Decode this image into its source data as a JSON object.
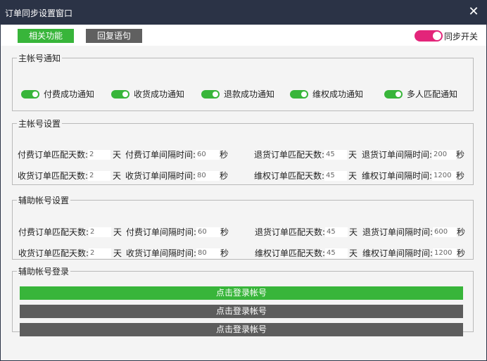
{
  "window": {
    "title": "订单同步设置窗口",
    "close_glyph": "✕"
  },
  "tabs": [
    {
      "label": "相关功能"
    },
    {
      "label": "回复语句"
    }
  ],
  "sync_toggle": {
    "label": "同步开关",
    "on": true,
    "color": "#e3257a"
  },
  "main_notify": {
    "legend": "主帐号通知",
    "items": [
      {
        "label": "付费成功通知",
        "on": true
      },
      {
        "label": "收货成功通知",
        "on": true
      },
      {
        "label": "退款成功通知",
        "on": true
      },
      {
        "label": "维权成功通知",
        "on": true
      },
      {
        "label": "多人匹配通知",
        "on": true
      }
    ]
  },
  "main_settings": {
    "legend": "主帐号设置",
    "rows": [
      [
        {
          "label": "付费订单匹配天数:",
          "value": "2",
          "unit": "天"
        },
        {
          "label": "付费订单间隔时间:",
          "value": "60",
          "unit": "秒"
        },
        {
          "label": "退货订单匹配天数:",
          "value": "45",
          "unit": "天"
        },
        {
          "label": "退货订单间隔时间:",
          "value": "200",
          "unit": "秒"
        }
      ],
      [
        {
          "label": "收货订单匹配天数:",
          "value": "2",
          "unit": "天"
        },
        {
          "label": "收货订单间隔时间:",
          "value": "80",
          "unit": "秒"
        },
        {
          "label": "维权订单匹配天数:",
          "value": "45",
          "unit": "天"
        },
        {
          "label": "维权订单间隔时间:",
          "value": "1200",
          "unit": "秒"
        }
      ]
    ]
  },
  "aux_settings": {
    "legend": "辅助帐号设置",
    "rows": [
      [
        {
          "label": "付费订单匹配天数:",
          "value": "2",
          "unit": "天"
        },
        {
          "label": "付费订单间隔时间:",
          "value": "60",
          "unit": "秒"
        },
        {
          "label": "退货订单匹配天数:",
          "value": "45",
          "unit": "天"
        },
        {
          "label": "退货订单间隔时间:",
          "value": "600",
          "unit": "秒"
        }
      ],
      [
        {
          "label": "收货订单匹配天数:",
          "value": "2",
          "unit": "天"
        },
        {
          "label": "收货订单间隔时间:",
          "value": "80",
          "unit": "秒"
        },
        {
          "label": "维权订单匹配天数:",
          "value": "45",
          "unit": "天"
        },
        {
          "label": "维权订单间隔时间:",
          "value": "1200",
          "unit": "秒"
        }
      ]
    ]
  },
  "aux_login": {
    "legend": "辅助帐号登录",
    "buttons": [
      {
        "label": "点击登录帐号",
        "color": "#38b53a"
      },
      {
        "label": "点击登录帐号",
        "color": "#5d5d5d"
      },
      {
        "label": "点击登录帐号",
        "color": "#5d5d5d"
      }
    ]
  }
}
